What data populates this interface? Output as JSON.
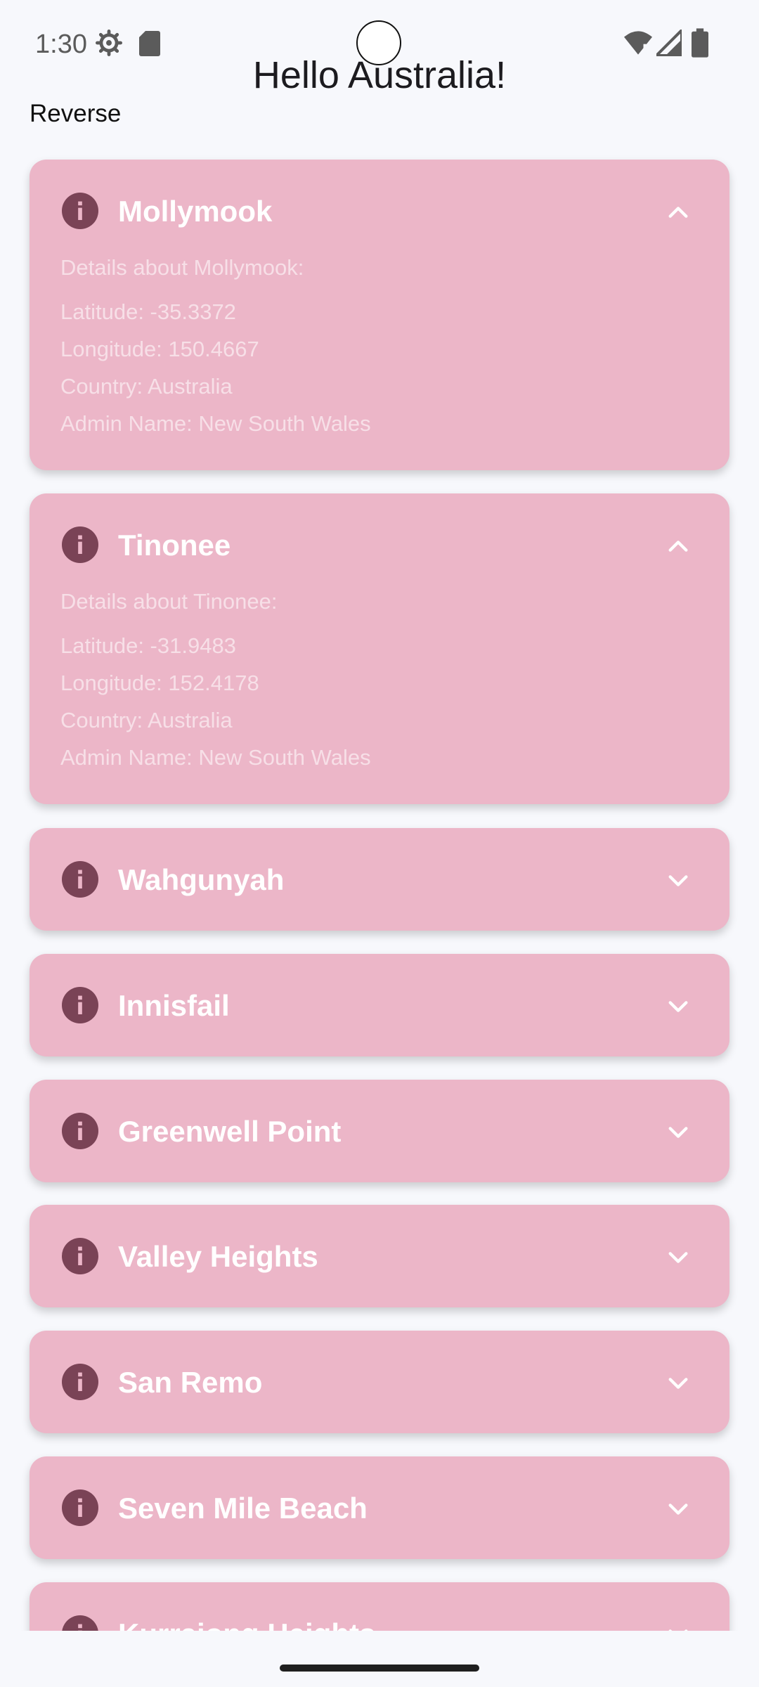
{
  "status_bar": {
    "time": "1:30",
    "icons": [
      "settings-icon",
      "sd-card-icon",
      "wifi-icon",
      "cellular-icon",
      "battery-icon"
    ]
  },
  "header": {
    "title": "Hello Australia!",
    "reverse_label": "Reverse"
  },
  "colors": {
    "card_background": "#ecb6c8",
    "icon_color": "#7a4356",
    "background": "#f7f8fc"
  },
  "cities": [
    {
      "name": "Mollymook",
      "expanded": true,
      "details_heading": "Details about Mollymook:",
      "latitude": "Latitude: -35.3372",
      "longitude": "Longitude: 150.4667",
      "country": "Country: Australia",
      "admin": "Admin Name: New South Wales"
    },
    {
      "name": "Tinonee",
      "expanded": true,
      "details_heading": "Details about Tinonee:",
      "latitude": "Latitude: -31.9483",
      "longitude": "Longitude: 152.4178",
      "country": "Country: Australia",
      "admin": "Admin Name: New South Wales"
    },
    {
      "name": "Wahgunyah",
      "expanded": false
    },
    {
      "name": "Innisfail",
      "expanded": false
    },
    {
      "name": "Greenwell Point",
      "expanded": false
    },
    {
      "name": "Valley Heights",
      "expanded": false
    },
    {
      "name": "San Remo",
      "expanded": false
    },
    {
      "name": "Seven Mile Beach",
      "expanded": false
    },
    {
      "name": "Kurrajong Heights",
      "expanded": false
    }
  ]
}
